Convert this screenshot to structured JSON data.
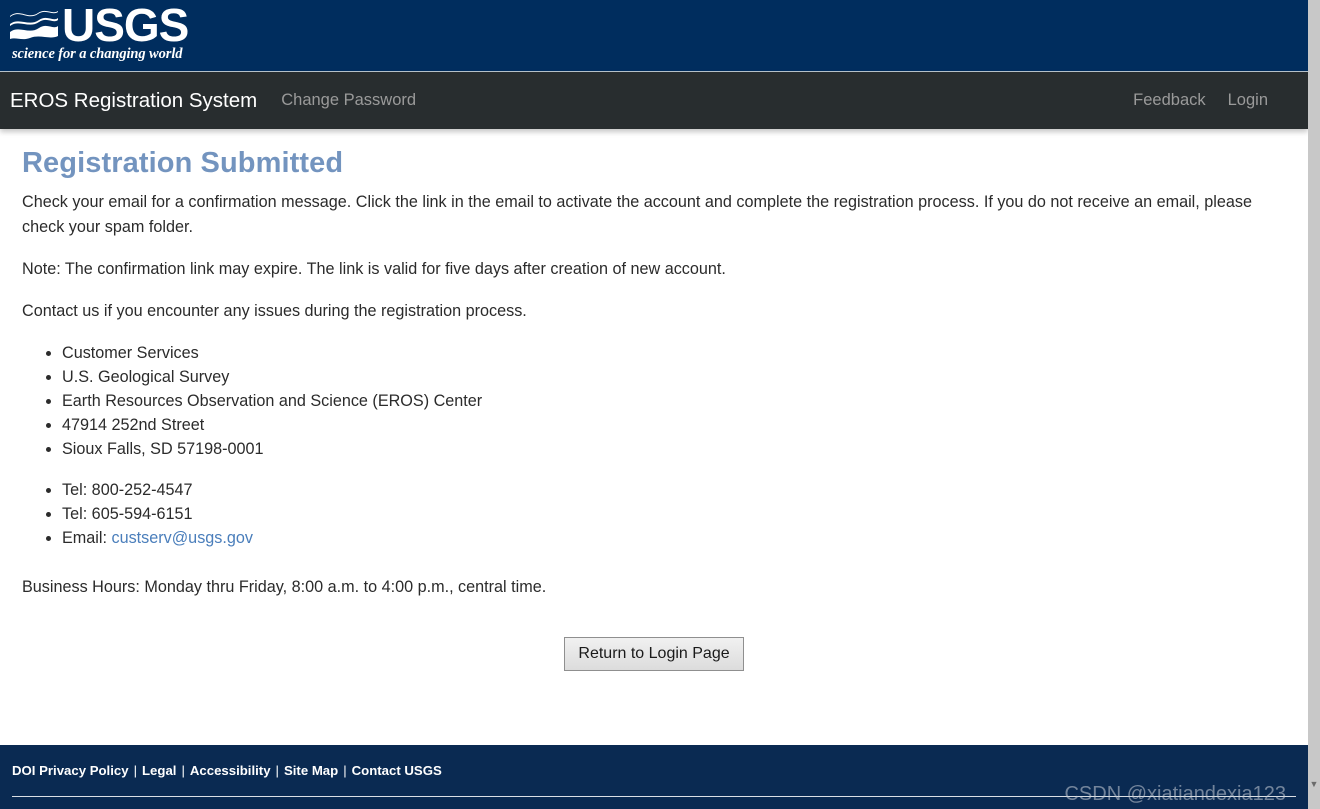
{
  "banner": {
    "logo_word": "USGS",
    "logo_tagline": "science for a changing world",
    "logo_icon": "usgs-wave-logo"
  },
  "navbar": {
    "brand": "EROS Registration System",
    "change_password": "Change Password",
    "feedback": "Feedback",
    "login": "Login"
  },
  "main": {
    "title": "Registration Submitted",
    "paragraph_1": "Check your email for a confirmation message. Click the link in the email to activate the account and complete the registration process. If you do not receive an email, please check your spam folder.",
    "paragraph_2": "Note: The confirmation link may expire. The link is valid for five days after creation of new account.",
    "paragraph_3": "Contact us if you encounter any issues during the registration process.",
    "address_list": [
      "Customer Services",
      "U.S. Geological Survey",
      "Earth Resources Observation and Science (EROS) Center",
      "47914 252nd Street",
      "Sioux Falls, SD 57198-0001"
    ],
    "phone_list": [
      "Tel: 800-252-4547",
      "Tel: 605-594-6151"
    ],
    "email_label": "Email:",
    "email_address": "custserv@usgs.gov",
    "business_hours": "Business Hours: Monday thru Friday, 8:00 a.m. to 4:00 p.m., central time.",
    "return_button": "Return to Login Page"
  },
  "footer": {
    "links": [
      "DOI Privacy Policy",
      "Legal",
      "Accessibility",
      "Site Map",
      "Contact USGS"
    ],
    "separator": "|"
  },
  "watermark": {
    "text": "CSDN @xiatiandexia123"
  },
  "colors": {
    "usgs_navy": "#002d5e",
    "navbar_dark": "#282d2f",
    "title_blue": "#7394bf",
    "link_blue": "#4a7ebb",
    "footer_navy": "#0a2a52"
  }
}
